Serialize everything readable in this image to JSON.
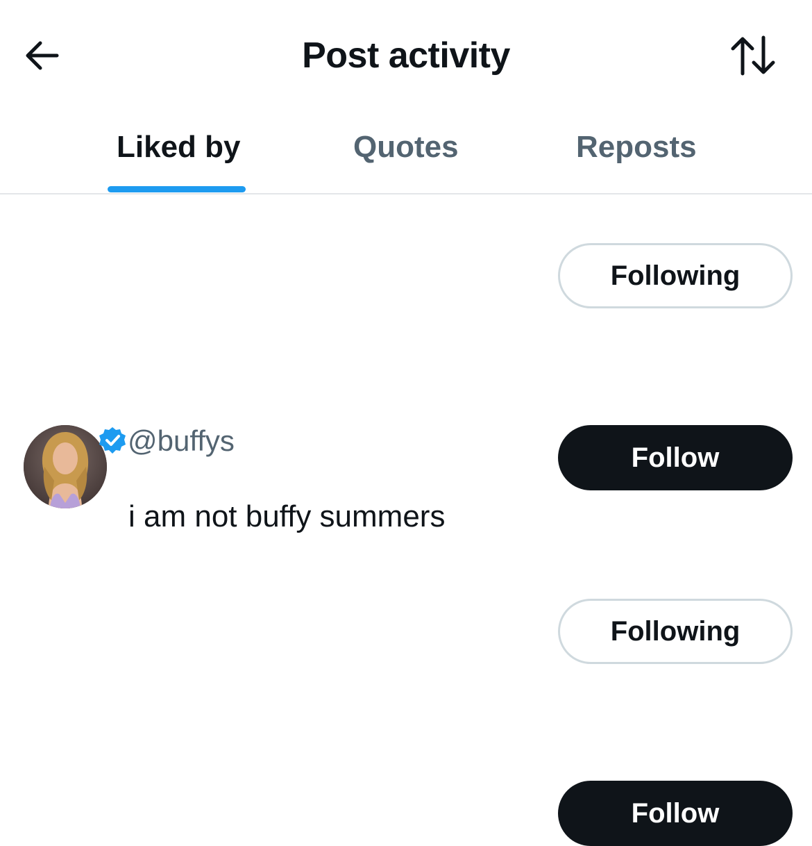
{
  "header": {
    "title": "Post activity",
    "back_icon": "arrow-left-icon",
    "sort_icon": "sort-arrows-icon"
  },
  "tabs": [
    {
      "label": "Liked by",
      "active": true
    },
    {
      "label": "Quotes",
      "active": false
    },
    {
      "label": "Reposts",
      "active": false
    }
  ],
  "accent_color": "#1d9bf0",
  "users": [
    {
      "button_label": "Following"
    },
    {
      "handle": "@buffys",
      "verified": true,
      "bio": "i am not buffy summers",
      "button_label": "Follow"
    },
    {
      "button_label": "Following"
    },
    {
      "button_label": "Follow"
    }
  ]
}
